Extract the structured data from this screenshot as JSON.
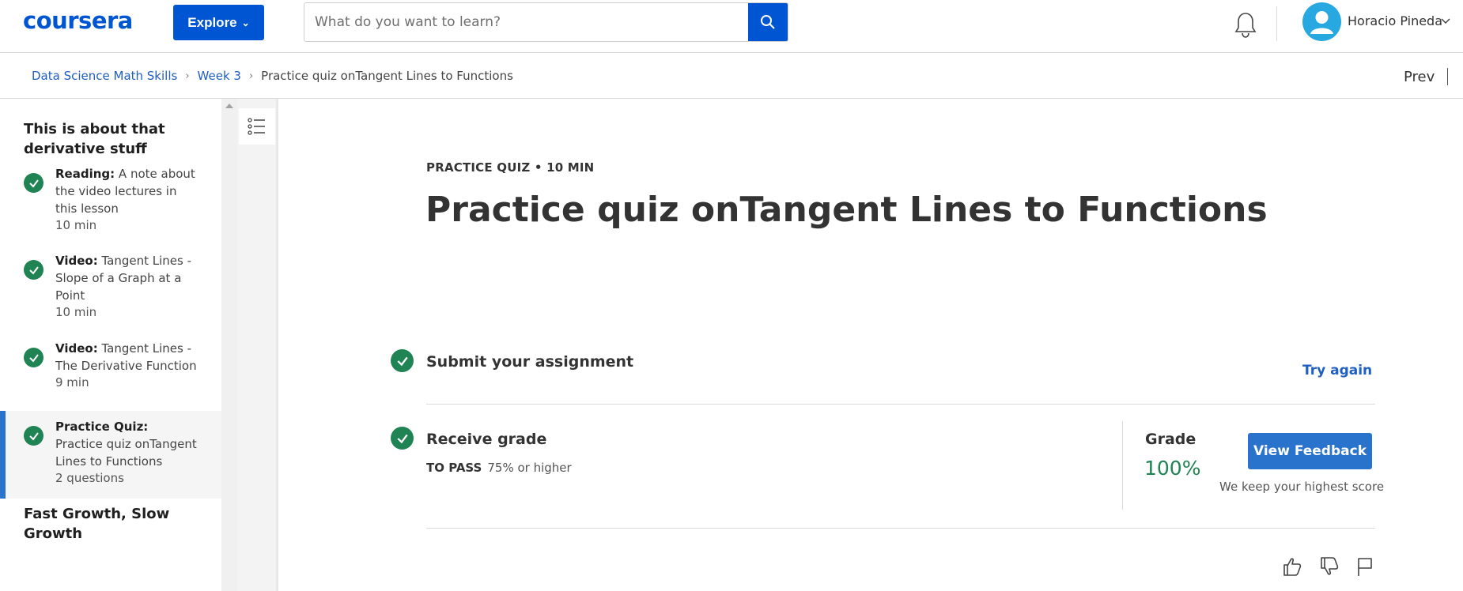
{
  "brand": {
    "logo_text": "coursera",
    "color": "#0056d2"
  },
  "nav": {
    "explore_label": "Explore",
    "search_placeholder": "What do you want to learn?",
    "user_name": "Horacio Pineda",
    "icons": [
      "search-icon",
      "bell-icon",
      "user-avatar-icon",
      "chevron-down-icon"
    ]
  },
  "breadcrumb": {
    "items": [
      "Data Science Math Skills",
      "Week 3",
      "Practice quiz onTangent Lines to Functions"
    ],
    "prev_label": "Prev"
  },
  "sidebar": {
    "section_title": "This is about that derivative stuff",
    "items": [
      {
        "type": "Reading:",
        "title": "A note about the video lectures in this lesson",
        "duration": "10 min",
        "completed": true,
        "active": false
      },
      {
        "type": "Video:",
        "title": "Tangent Lines - Slope of a Graph at a Point",
        "duration": "10 min",
        "completed": true,
        "active": false
      },
      {
        "type": "Video:",
        "title": "Tangent Lines - The Derivative Function",
        "duration": "9 min",
        "completed": true,
        "active": false
      },
      {
        "type": "Practice Quiz:",
        "title": "Practice quiz onTangent Lines to Functions",
        "duration": "2 questions",
        "completed": true,
        "active": true
      }
    ],
    "next_section_title": "Fast Growth, Slow Growth"
  },
  "quiz": {
    "meta": "PRACTICE QUIZ • 10 MIN",
    "title": "Practice quiz onTangent Lines to Functions",
    "submit_label": "Submit your assignment",
    "try_again_label": "Try again",
    "receive_label": "Receive grade",
    "to_pass_label": "TO PASS",
    "to_pass_value": "75% or higher",
    "grade_label": "Grade",
    "grade_value": "100%",
    "view_feedback_label": "View Feedback",
    "keep_note": "We keep your highest score"
  },
  "colors": {
    "accent": "#2a73cc",
    "success": "#1f8354",
    "link": "#1f5ec2"
  }
}
